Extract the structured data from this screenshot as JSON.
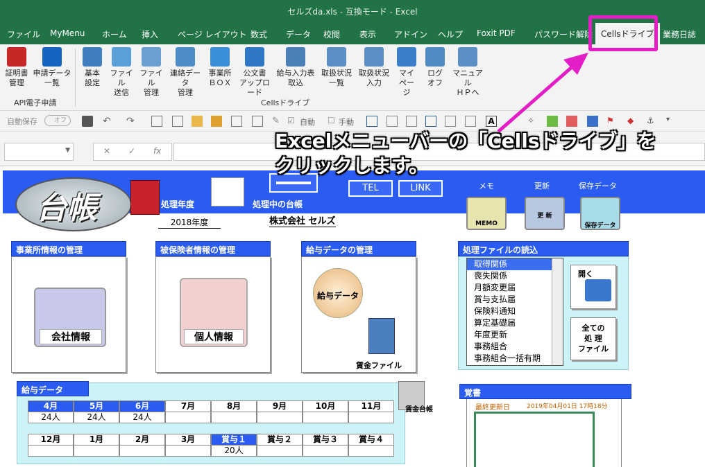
{
  "window": {
    "title": "セルズda.xls  -  互換モード  -  Excel"
  },
  "tabs": [
    "ファイル",
    "MyMenu",
    "ホーム",
    "挿入",
    "ページ レイアウト",
    "数式",
    "データ",
    "校閲",
    "表示",
    "アドイン",
    "ヘルプ",
    "Foxit PDF",
    "パスワード解除",
    "Cellsドライブ",
    "業務日誌"
  ],
  "ribbon": {
    "group1": {
      "label": "API電子申請",
      "buttons": [
        [
          "証明書",
          "管理"
        ],
        [
          "申請データ",
          "一覧"
        ]
      ]
    },
    "group2": {
      "label": "Cellsドライブ",
      "buttons": [
        [
          "基本",
          "設定"
        ],
        [
          "ファイル",
          "送信"
        ],
        [
          "ファイル",
          "管理"
        ],
        [
          "連絡データ",
          "管理"
        ],
        [
          "事業所",
          "ＢＯＸ"
        ],
        [
          "公文書",
          "アップロード"
        ],
        [
          "給与入力表",
          "取込"
        ],
        [
          "取扱状況",
          "一覧"
        ],
        [
          "取扱状況",
          "入力"
        ],
        [
          "マイ",
          "ページ"
        ],
        [
          "ログ",
          "オフ"
        ],
        [
          "マニュアル",
          "ＨＰへ"
        ]
      ]
    }
  },
  "qat": {
    "autosave": "自動保存",
    "toggle": "オフ",
    "auto": "自動",
    "manual": "手動"
  },
  "formula": {
    "fx": "fx"
  },
  "annotation": {
    "line1": "Excelメニューバーの「Cellsドライブ」を",
    "line2": "クリックします。"
  },
  "sheet": {
    "logo": "台帳",
    "year_label": "処理年度",
    "year_value": "2018年度",
    "ledger_label": "処理中の台帳",
    "ledger_value": "株式会社 セルズ",
    "tel": "TEL",
    "link": "LINK",
    "memo_lbl": "メモ",
    "update_lbl": "更新",
    "save_lbl": "保存データ",
    "memo_btn": "MEMO",
    "update_btn": "更 新",
    "save_btn": "保存データ",
    "p1": {
      "title": "事業所情報の管理",
      "btn": "会社情報"
    },
    "p2": {
      "title": "被保険者情報の管理",
      "btn": "個人情報"
    },
    "p3": {
      "title": "給与データの管理",
      "btn": "給与データ",
      "file": "賃金ファイル"
    },
    "p4": {
      "title": "処理ファイルの読込",
      "items": [
        "取得関係",
        "喪失関係",
        "月額変更届",
        "賞与支払届",
        "保険料通知",
        "算定基礎届",
        "年度更新",
        "事務組合",
        "事務組合一括有期"
      ],
      "open": "開く",
      "all": [
        "全ての",
        "処 理",
        "ファイル"
      ]
    },
    "salary": {
      "title": "給与データ",
      "row1": [
        "4月",
        "5月",
        "6月",
        "7月",
        "8月",
        "9月",
        "10月",
        "11月"
      ],
      "row1v": [
        "24人",
        "24人",
        "24人",
        "",
        "",
        "",
        "",
        ""
      ],
      "row2": [
        "12月",
        "1月",
        "2月",
        "3月",
        "賞与１",
        "賞与２",
        "賞与３",
        "賞与４"
      ],
      "row2v": [
        "",
        "",
        "",
        "",
        "20人",
        "",
        "",
        ""
      ],
      "ledger": "賃金台帳"
    },
    "memo": {
      "title": "覚書",
      "updated": "最終更新日",
      "date": "2019年04月01日  17時18分"
    }
  },
  "colors": {
    "excel_green": "#217346",
    "sheet_blue": "#2a5cf2",
    "highlight": "#e31ec6"
  }
}
